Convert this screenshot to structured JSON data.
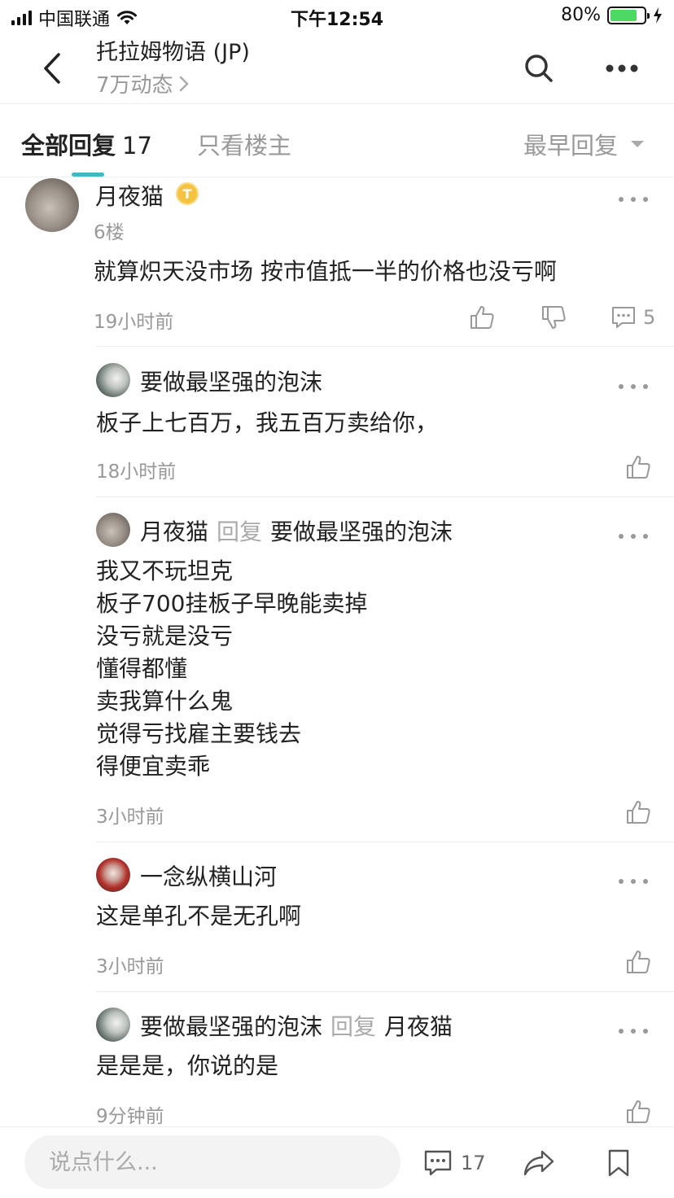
{
  "status_bar": {
    "carrier": "中国联通",
    "time": "下午12:54",
    "battery": "80%",
    "battery_level": 0.8
  },
  "nav": {
    "title": "托拉姆物语 (JP)",
    "subtitle": "7万动态",
    "back_icon": "chevron-left-icon",
    "search_icon": "search-icon",
    "more_icon": "more-icon"
  },
  "tabs": {
    "all_label": "全部回复",
    "all_count": "17",
    "op_only_label": "只看楼主",
    "sort_label": "最早回复",
    "accent_color": "#3fb8c4"
  },
  "post": {
    "author": "月夜猫",
    "badge": "T",
    "floor": "6楼",
    "content": "就算炽天没市场 按市值抵一半的价格也没亏啊",
    "time": "19小时前",
    "comment_count": "5"
  },
  "replies": [
    {
      "author": "要做最坚强的泡沫",
      "reply_word": "",
      "reply_to": "",
      "lines": [
        "板子上七百万，我五百万卖给你，"
      ],
      "time": "18小时前"
    },
    {
      "author": "月夜猫",
      "reply_word": "回复",
      "reply_to": "要做最坚强的泡沫",
      "lines": [
        "我又不玩坦克",
        "板子700挂板子早晚能卖掉",
        "没亏就是没亏",
        "懂得都懂",
        "卖我算什么鬼",
        "觉得亏找雇主要钱去",
        "得便宜卖乖"
      ],
      "time": "3小时前"
    },
    {
      "author": "一念纵横山河",
      "reply_word": "",
      "reply_to": "",
      "lines": [
        "这是单孔不是无孔啊"
      ],
      "time": "3小时前"
    },
    {
      "author": "要做最坚强的泡沫",
      "reply_word": "回复",
      "reply_to": "月夜猫",
      "lines": [
        "是是是，你说的是"
      ],
      "time": "9分钟前"
    }
  ],
  "bottom_bar": {
    "input_placeholder": "说点什么...",
    "comment_count": "17",
    "comment_icon": "comment-icon",
    "share_icon": "share-icon",
    "bookmark_icon": "bookmark-icon"
  }
}
